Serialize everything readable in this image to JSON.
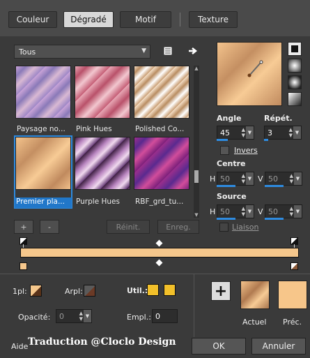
{
  "tabs": [
    {
      "label": "Couleur"
    },
    {
      "label": "Dégradé"
    },
    {
      "label": "Motif"
    },
    {
      "label": "Texture"
    }
  ],
  "gradient_select": {
    "value": "Tous"
  },
  "thumbnails": [
    {
      "label": "Paysage no..."
    },
    {
      "label": "Pink Hues"
    },
    {
      "label": "Polished Co..."
    },
    {
      "label": "Premier pla..."
    },
    {
      "label": "Purple Hues"
    },
    {
      "label": "RBF_grd_tu..."
    }
  ],
  "list_buttons": {
    "add": "+",
    "remove": "-",
    "reset": "Réinit.",
    "save": "Enreg."
  },
  "angle": {
    "label": "Angle",
    "value": "45"
  },
  "repeat": {
    "label": "Répét.",
    "value": "3"
  },
  "invert": {
    "label": "Invers"
  },
  "center": {
    "label": "Centre",
    "h_label": "H",
    "h_value": "50",
    "v_label": "V",
    "v_value": "50"
  },
  "source": {
    "label": "Source",
    "h_label": "H",
    "h_value": "50",
    "v_label": "V",
    "v_value": "50"
  },
  "link": {
    "label": "Liaison"
  },
  "stops": {
    "foreground_label": "1pl:",
    "background_label": "Arpl:",
    "user_label": "Util.:",
    "opacity_label": "Opacité:",
    "opacity_value": "0",
    "location_label": "Empl.:",
    "location_value": "0"
  },
  "swatches": {
    "current_label": "Actuel",
    "previous_label": "Préc."
  },
  "footer": {
    "help": "Aide",
    "watermark": "Traduction @Cloclo Design",
    "ok": "OK",
    "cancel": "Annuler"
  },
  "colors": {
    "accent": "#2e8be0",
    "user_color": "#f2c02a",
    "prev_color": "#f7c68a"
  }
}
